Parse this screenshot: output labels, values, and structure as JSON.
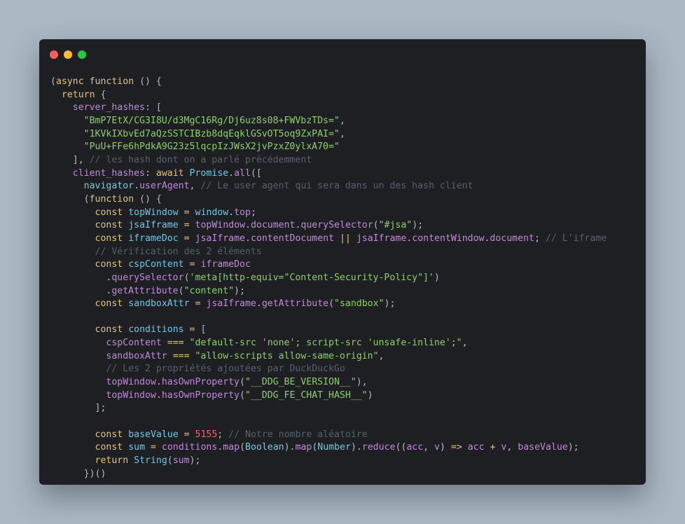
{
  "window": {
    "controls": [
      {
        "name": "close",
        "color": "#ff5f56"
      },
      {
        "name": "minimize",
        "color": "#ffbd2e"
      },
      {
        "name": "zoom",
        "color": "#27c93f"
      }
    ]
  },
  "code": {
    "lines": [
      [
        [
          "punct",
          "("
        ],
        [
          "kw",
          "async"
        ],
        [
          "punct",
          " "
        ],
        [
          "kw",
          "function"
        ],
        [
          "punct",
          " () {"
        ]
      ],
      [
        [
          "punct",
          "  "
        ],
        [
          "kw",
          "return"
        ],
        [
          "punct",
          " {"
        ]
      ],
      [
        [
          "punct",
          "    "
        ],
        [
          "fn",
          "server_hashes"
        ],
        [
          "punct",
          ": ["
        ]
      ],
      [
        [
          "punct",
          "      "
        ],
        [
          "str",
          "\"BmP7EtX/CG3I8U/d3MgC16Rg/Dj6uz8s08+FWVbzTDs=\""
        ],
        [
          "punct",
          ","
        ]
      ],
      [
        [
          "punct",
          "      "
        ],
        [
          "str",
          "\"1KVkIXbvEd7aQzSSTCIBzb8dqEqklGSvOT5oq9ZxPAI=\""
        ],
        [
          "punct",
          ","
        ]
      ],
      [
        [
          "punct",
          "      "
        ],
        [
          "str",
          "\"PuU+FFe6hPdkA9G23z5lqcpIzJWsX2jvPzxZ0ylxA70=\""
        ]
      ],
      [
        [
          "punct",
          "    ], "
        ],
        [
          "com",
          "// les hash dont on a parlé précédemment"
        ]
      ],
      [
        [
          "punct",
          "    "
        ],
        [
          "fn",
          "client_hashes"
        ],
        [
          "punct",
          ": "
        ],
        [
          "kw",
          "await"
        ],
        [
          "punct",
          " "
        ],
        [
          "var",
          "Promise"
        ],
        [
          "punct",
          "."
        ],
        [
          "fn",
          "all"
        ],
        [
          "punct",
          "(["
        ]
      ],
      [
        [
          "punct",
          "      "
        ],
        [
          "var",
          "navigator"
        ],
        [
          "punct",
          "."
        ],
        [
          "fn",
          "userAgent"
        ],
        [
          "punct",
          ", "
        ],
        [
          "com",
          "// Le user agent qui sera dans un des hash client"
        ]
      ],
      [
        [
          "punct",
          "      ("
        ],
        [
          "kw",
          "function"
        ],
        [
          "punct",
          " () {"
        ]
      ],
      [
        [
          "punct",
          "        "
        ],
        [
          "kw",
          "const"
        ],
        [
          "punct",
          " "
        ],
        [
          "var",
          "topWindow"
        ],
        [
          "punct",
          " "
        ],
        [
          "op",
          "="
        ],
        [
          "punct",
          " "
        ],
        [
          "var",
          "window"
        ],
        [
          "punct",
          "."
        ],
        [
          "fn",
          "top"
        ],
        [
          "punct",
          ";"
        ]
      ],
      [
        [
          "punct",
          "        "
        ],
        [
          "kw",
          "const"
        ],
        [
          "punct",
          " "
        ],
        [
          "var",
          "jsaIframe"
        ],
        [
          "punct",
          " "
        ],
        [
          "op",
          "="
        ],
        [
          "punct",
          " "
        ],
        [
          "fn",
          "topWindow"
        ],
        [
          "punct",
          "."
        ],
        [
          "fn",
          "document"
        ],
        [
          "punct",
          "."
        ],
        [
          "fn",
          "querySelector"
        ],
        [
          "punct",
          "("
        ],
        [
          "str",
          "\"#jsa\""
        ],
        [
          "punct",
          ");"
        ]
      ],
      [
        [
          "punct",
          "        "
        ],
        [
          "kw",
          "const"
        ],
        [
          "punct",
          " "
        ],
        [
          "var",
          "iframeDoc"
        ],
        [
          "punct",
          " "
        ],
        [
          "op",
          "="
        ],
        [
          "punct",
          " "
        ],
        [
          "fn",
          "jsaIframe"
        ],
        [
          "punct",
          "."
        ],
        [
          "fn",
          "contentDocument"
        ],
        [
          "punct",
          " "
        ],
        [
          "op",
          "||"
        ],
        [
          "punct",
          " "
        ],
        [
          "fn",
          "jsaIframe"
        ],
        [
          "punct",
          "."
        ],
        [
          "fn",
          "contentWindow"
        ],
        [
          "punct",
          "."
        ],
        [
          "fn",
          "document"
        ],
        [
          "punct",
          "; "
        ],
        [
          "com",
          "// L'iframe"
        ]
      ],
      [
        [
          "punct",
          "        "
        ],
        [
          "com",
          "// Vérification des 2 éléments"
        ]
      ],
      [
        [
          "punct",
          "        "
        ],
        [
          "kw",
          "const"
        ],
        [
          "punct",
          " "
        ],
        [
          "var",
          "cspContent"
        ],
        [
          "punct",
          " "
        ],
        [
          "op",
          "="
        ],
        [
          "punct",
          " "
        ],
        [
          "fn",
          "iframeDoc"
        ]
      ],
      [
        [
          "punct",
          "          ."
        ],
        [
          "fn",
          "querySelector"
        ],
        [
          "punct",
          "("
        ],
        [
          "str",
          "'meta[http-equiv=\"Content-Security-Policy\"]'"
        ],
        [
          "punct",
          ")"
        ]
      ],
      [
        [
          "punct",
          "          ."
        ],
        [
          "fn",
          "getAttribute"
        ],
        [
          "punct",
          "("
        ],
        [
          "str",
          "\"content\""
        ],
        [
          "punct",
          ");"
        ]
      ],
      [
        [
          "punct",
          "        "
        ],
        [
          "kw",
          "const"
        ],
        [
          "punct",
          " "
        ],
        [
          "var",
          "sandboxAttr"
        ],
        [
          "punct",
          " "
        ],
        [
          "op",
          "="
        ],
        [
          "punct",
          " "
        ],
        [
          "fn",
          "jsaIframe"
        ],
        [
          "punct",
          "."
        ],
        [
          "fn",
          "getAttribute"
        ],
        [
          "punct",
          "("
        ],
        [
          "str",
          "\"sandbox\""
        ],
        [
          "punct",
          ");"
        ]
      ],
      [
        [
          "punct",
          ""
        ]
      ],
      [
        [
          "punct",
          "        "
        ],
        [
          "kw",
          "const"
        ],
        [
          "punct",
          " "
        ],
        [
          "var",
          "conditions"
        ],
        [
          "punct",
          " "
        ],
        [
          "op",
          "="
        ],
        [
          "punct",
          " ["
        ]
      ],
      [
        [
          "punct",
          "          "
        ],
        [
          "fn",
          "cspContent"
        ],
        [
          "punct",
          " "
        ],
        [
          "op",
          "==="
        ],
        [
          "punct",
          " "
        ],
        [
          "str",
          "\"default-src 'none'; script-src 'unsafe-inline';\""
        ],
        [
          "punct",
          ","
        ]
      ],
      [
        [
          "punct",
          "          "
        ],
        [
          "fn",
          "sandboxAttr"
        ],
        [
          "punct",
          " "
        ],
        [
          "op",
          "==="
        ],
        [
          "punct",
          " "
        ],
        [
          "str",
          "\"allow-scripts allow-same-origin\""
        ],
        [
          "punct",
          ","
        ]
      ],
      [
        [
          "punct",
          "          "
        ],
        [
          "com",
          "// Les 2 propriétés ajoutées par DuckDuckGo"
        ]
      ],
      [
        [
          "punct",
          "          "
        ],
        [
          "fn",
          "topWindow"
        ],
        [
          "punct",
          "."
        ],
        [
          "fn",
          "hasOwnProperty"
        ],
        [
          "punct",
          "("
        ],
        [
          "str",
          "\"__DDG_BE_VERSION__\""
        ],
        [
          "punct",
          "),"
        ]
      ],
      [
        [
          "punct",
          "          "
        ],
        [
          "fn",
          "topWindow"
        ],
        [
          "punct",
          "."
        ],
        [
          "fn",
          "hasOwnProperty"
        ],
        [
          "punct",
          "("
        ],
        [
          "str",
          "\"__DDG_FE_CHAT_HASH__\""
        ],
        [
          "punct",
          ")"
        ]
      ],
      [
        [
          "punct",
          "        ];"
        ]
      ],
      [
        [
          "punct",
          ""
        ]
      ],
      [
        [
          "punct",
          "        "
        ],
        [
          "kw",
          "const"
        ],
        [
          "punct",
          " "
        ],
        [
          "var",
          "baseValue"
        ],
        [
          "punct",
          " "
        ],
        [
          "op",
          "="
        ],
        [
          "punct",
          " "
        ],
        [
          "num",
          "5155"
        ],
        [
          "punct",
          "; "
        ],
        [
          "com",
          "// Notre nombre aléatoire"
        ]
      ],
      [
        [
          "punct",
          "        "
        ],
        [
          "kw",
          "const"
        ],
        [
          "punct",
          " "
        ],
        [
          "var",
          "sum"
        ],
        [
          "punct",
          " "
        ],
        [
          "op",
          "="
        ],
        [
          "punct",
          " "
        ],
        [
          "fn",
          "conditions"
        ],
        [
          "punct",
          "."
        ],
        [
          "fn",
          "map"
        ],
        [
          "punct",
          "("
        ],
        [
          "var",
          "Boolean"
        ],
        [
          "punct",
          ")."
        ],
        [
          "fn",
          "map"
        ],
        [
          "punct",
          "("
        ],
        [
          "var",
          "Number"
        ],
        [
          "punct",
          ")."
        ],
        [
          "fn",
          "reduce"
        ],
        [
          "punct",
          "(("
        ],
        [
          "fn",
          "acc"
        ],
        [
          "punct",
          ", "
        ],
        [
          "fn",
          "v"
        ],
        [
          "punct",
          ") "
        ],
        [
          "op",
          "=>"
        ],
        [
          "punct",
          " "
        ],
        [
          "fn",
          "acc"
        ],
        [
          "punct",
          " "
        ],
        [
          "op",
          "+"
        ],
        [
          "punct",
          " "
        ],
        [
          "fn",
          "v"
        ],
        [
          "punct",
          ", "
        ],
        [
          "fn",
          "baseValue"
        ],
        [
          "punct",
          ");"
        ]
      ],
      [
        [
          "punct",
          "        "
        ],
        [
          "kw",
          "return"
        ],
        [
          "punct",
          " "
        ],
        [
          "var",
          "String"
        ],
        [
          "punct",
          "("
        ],
        [
          "fn",
          "sum"
        ],
        [
          "punct",
          ");"
        ]
      ],
      [
        [
          "punct",
          "      })()"
        ]
      ]
    ]
  }
}
